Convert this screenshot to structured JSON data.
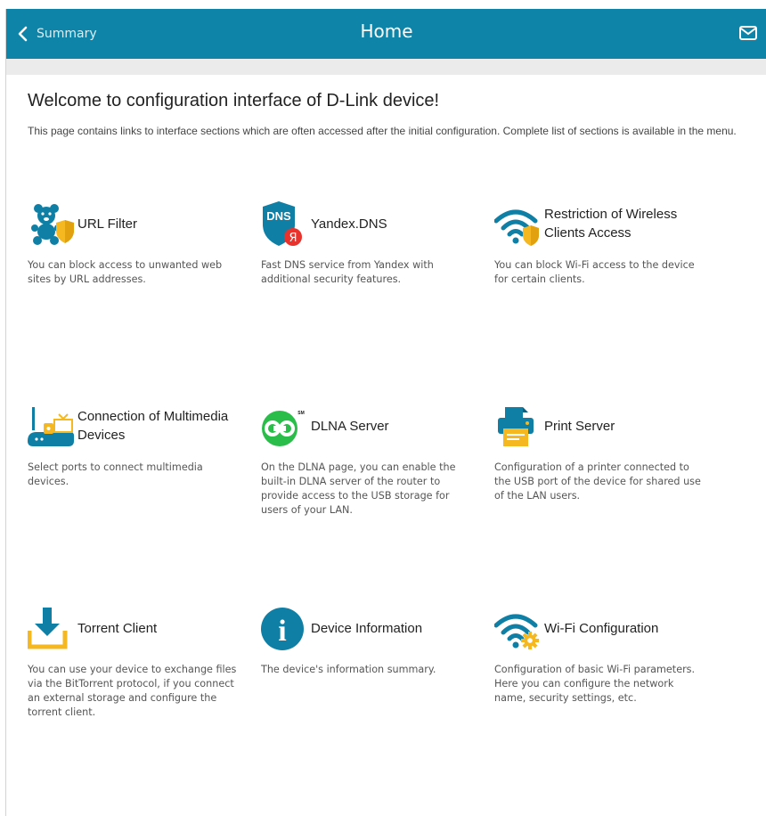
{
  "header": {
    "back_label": "Summary",
    "title": "Home"
  },
  "welcome": {
    "heading": "Welcome to configuration interface of D-Link device!",
    "description": "This page contains links to interface sections which are often accessed after the initial configuration. Complete list of sections is available in the menu."
  },
  "tiles": [
    {
      "name": "URL Filter",
      "description": "You can block access to unwanted web sites by URL addresses.",
      "icon": "teddy-bear-shield-icon"
    },
    {
      "name": "Yandex.DNS",
      "description": "Fast DNS service from Yandex with additional security features.",
      "icon": "yandex-dns-icon",
      "icon_text": "DNS",
      "badge_text": "Я"
    },
    {
      "name": "Restriction of Wireless Clients Access",
      "description": "You can block Wi-Fi access to the device for certain clients.",
      "icon": "wifi-shield-icon"
    },
    {
      "name": "Connection of Multimedia Devices",
      "description": "Select ports to connect multimedia devices.",
      "icon": "router-multimedia-icon"
    },
    {
      "name": "DLNA Server",
      "description": "On the DLNA page, you can enable the built-in DLNA server of the router to provide access to the USB storage for users of your LAN.",
      "icon": "dlna-icon",
      "icon_text": "SM"
    },
    {
      "name": "Print Server",
      "description": "Configuration of a printer connected to the USB port of the device for shared use of the LAN users.",
      "icon": "printer-icon"
    },
    {
      "name": "Torrent Client",
      "description": "You can use your device to exchange files via the BitTorrent protocol, if you connect an external storage and configure the torrent client.",
      "icon": "download-tray-icon"
    },
    {
      "name": "Device Information",
      "description": "The device's information summary.",
      "icon": "info-icon",
      "icon_text": "i"
    },
    {
      "name": "Wi-Fi Configuration",
      "description": "Configuration of basic Wi-Fi parameters. Here you can configure the network name, security settings, etc.",
      "icon": "wifi-gear-icon"
    }
  ],
  "colors": {
    "header": "#0e85a8",
    "icon_blue": "#0f7fa5",
    "accent_yellow": "#f5b820",
    "dlna_green": "#2bbd4a",
    "yandex_red": "#e8322b"
  }
}
